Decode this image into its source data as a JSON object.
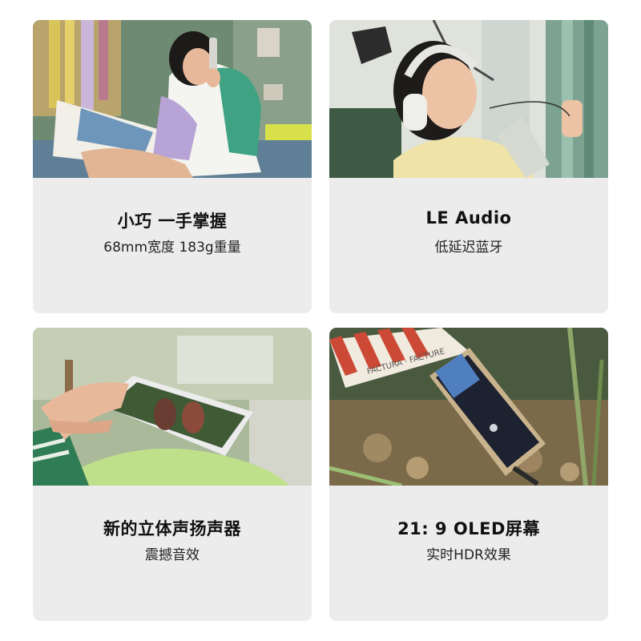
{
  "features": [
    {
      "title": "小巧 一手掌握",
      "subtitle": "68mm宽度 183g重量",
      "image": "woman-on-phone-call-photo"
    },
    {
      "title": "LE Audio",
      "subtitle": "低延迟蓝牙",
      "image": "woman-wearing-headphones-photo"
    },
    {
      "title": "新的立体声扬声器",
      "subtitle": "震撼音效",
      "image": "hands-holding-phone-landscape-photo"
    },
    {
      "title": "21: 9 OLED屏幕",
      "subtitle": "实时HDR效果",
      "image": "phone-on-stand-in-aquarium-photo",
      "sign_text": "FACTURA · FACTURE"
    }
  ],
  "colors": {
    "card_background": "#ececec",
    "title_text": "#111111",
    "subtitle_text": "#222222"
  }
}
